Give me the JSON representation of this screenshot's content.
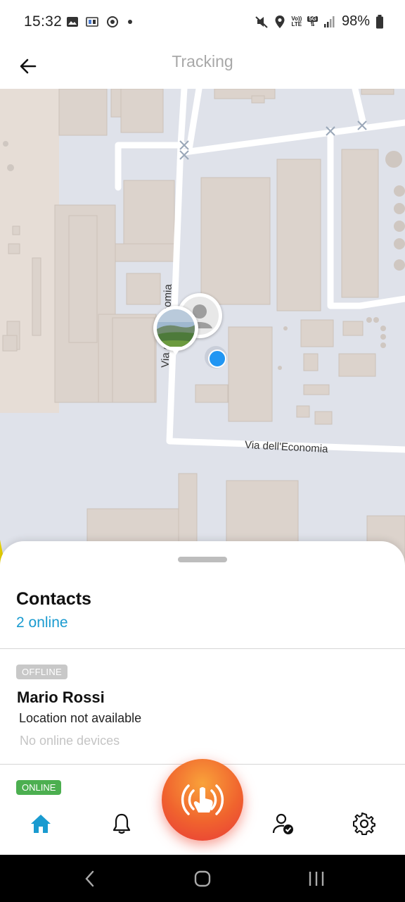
{
  "status_bar": {
    "time": "15:32",
    "battery_percent": "98%",
    "icons": [
      "image-icon",
      "app-icon",
      "sync-icon",
      "dot-icon",
      "mute-icon",
      "location-icon",
      "volte-icon",
      "5g-icon",
      "signal-icon",
      "battery-icon"
    ],
    "volte_top": "Vo))",
    "volte_bottom": "LTE",
    "net": "5G"
  },
  "header": {
    "title": "Tracking",
    "back_icon": "arrow-left-icon"
  },
  "map": {
    "street_horizontal": "Via dell'Economia",
    "street_vertical": "Via dell'Economia",
    "locate_icon": "crosshair-icon",
    "colors": {
      "background": "#dfe2ea",
      "building": "#dcd3cc",
      "road": "#ffffff",
      "my_location": "#2196f3"
    }
  },
  "contacts_sheet": {
    "title": "Contacts",
    "online_summary": "2 online",
    "items": [
      {
        "status": "OFFLINE",
        "name": "Mario Rossi",
        "location": "Location not available",
        "devices": "No online devices"
      }
    ]
  },
  "bottom_nav": {
    "status_badge": "ONLINE",
    "items": [
      "home-icon",
      "bell-icon",
      "contacts-check-icon",
      "gear-icon"
    ],
    "sos_icon": "tap-alert-icon",
    "colors": {
      "accent": "#1a9bd0",
      "online": "#4caf50",
      "offline": "#c8c8c8"
    }
  },
  "system_nav": {
    "items": [
      "back-icon",
      "home-icon",
      "recents-icon"
    ]
  }
}
